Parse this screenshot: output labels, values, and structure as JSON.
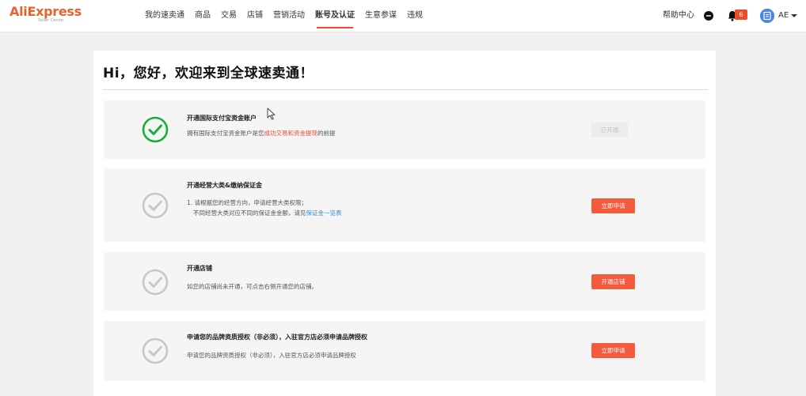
{
  "app": {
    "logo_text": "AliExpress",
    "logo_sub": "Seller Center"
  },
  "nav": {
    "items": [
      "我的速卖通",
      "商品",
      "交易",
      "店铺",
      "营销活动",
      "账号及认证",
      "生意参谋",
      "违规"
    ],
    "active_index": 5
  },
  "header_right": {
    "help": "帮助中心",
    "notification_count": "6",
    "user_code": "AE"
  },
  "colors": {
    "accent": "#ee4b2b",
    "button": "#f65a3c",
    "success": "#1aad3f",
    "link": "#2f8cd8"
  },
  "main": {
    "greeting": "Hi，您好，欢迎来到全球速卖通！",
    "steps": [
      {
        "title": "开通国际支付宝资金账户",
        "desc_prefix": "拥有国际支付宝资金账户是您",
        "desc_highlight": "成功交易和资金提现",
        "desc_suffix": "的前提",
        "button": "已开通",
        "status": "done"
      },
      {
        "title": "开通经营大类&缴纳保证金",
        "desc_line1": "1. 请根据您的经营方向，申请经营大类权限；",
        "desc_line2_prefix": "不同经营大类对应不同的保证金金额，请见",
        "desc_line2_link": "保证金一览表",
        "button": "立即申请",
        "status": "pending"
      },
      {
        "title": "开通店铺",
        "desc": "如您的店铺尚未开通，可点击右侧开通您的店铺。",
        "button": "开通店铺",
        "status": "pending"
      },
      {
        "title": "申请您的品牌资质授权（非必须），入驻官方店必须申请品牌授权",
        "desc": "申请您的品牌资质授权（非必须），入驻官方店必须申请品牌授权",
        "button": "立即申请",
        "status": "pending"
      }
    ]
  }
}
